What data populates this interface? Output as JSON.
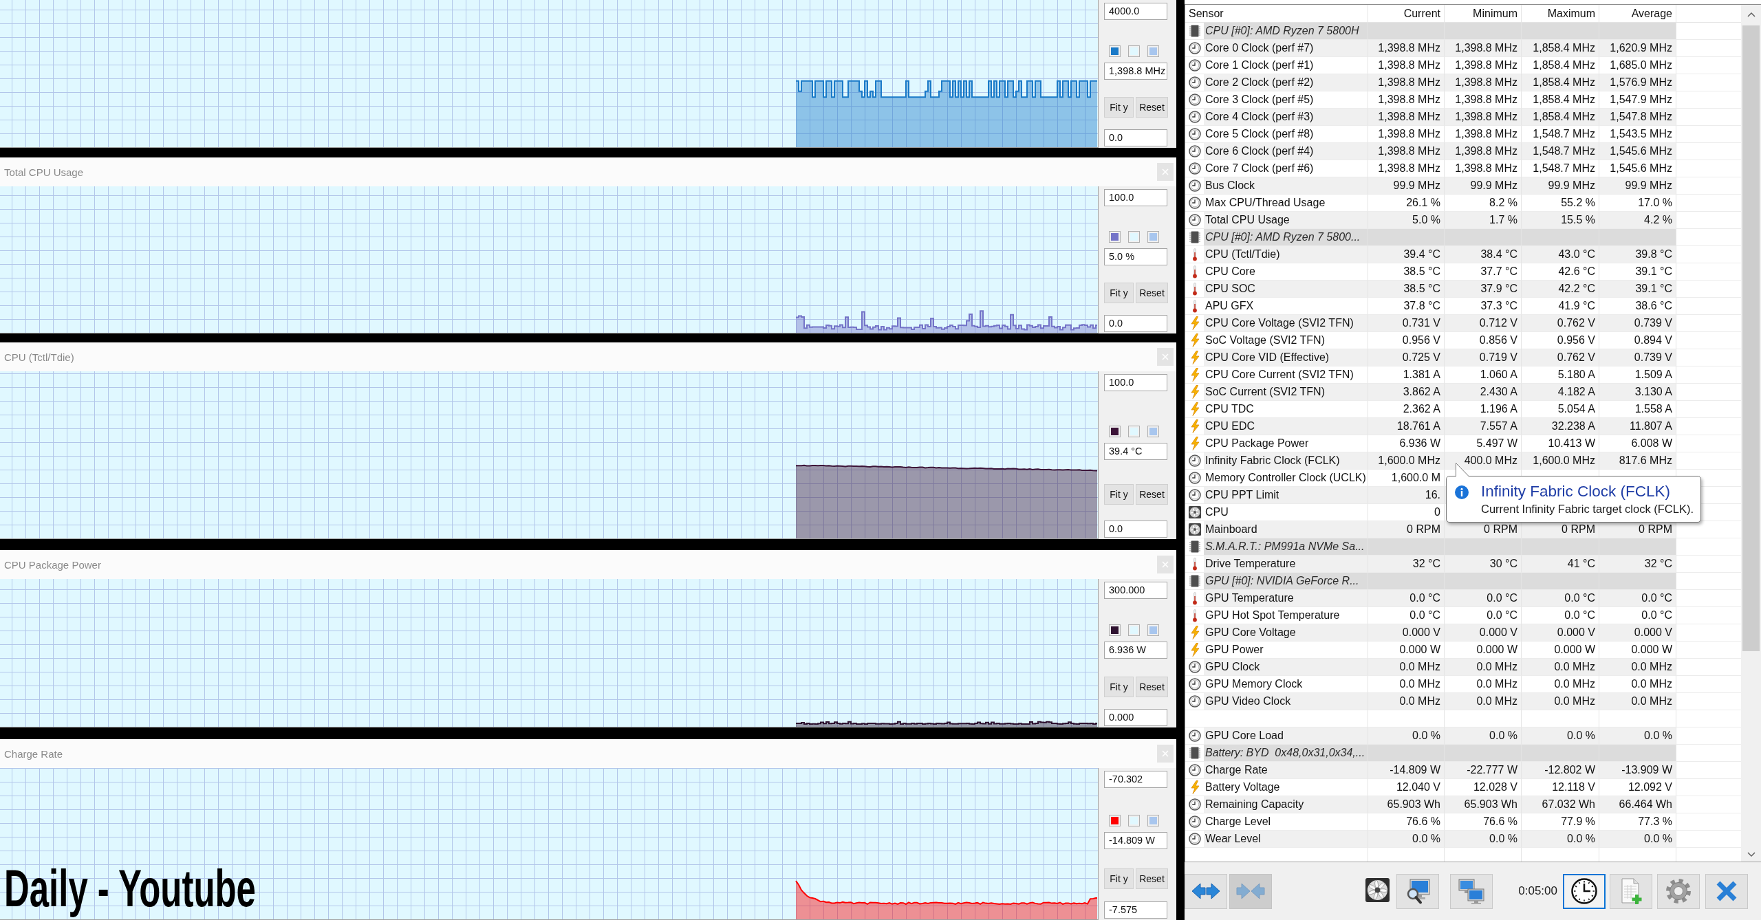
{
  "graphs": [
    {
      "kind": "clock",
      "color": "#1a7ac8",
      "max": "4000.0",
      "current": "1,398.8 MHz",
      "min": "0.0",
      "buttons": [
        "Fit y",
        "Reset"
      ]
    },
    {
      "title": "Total CPU Usage",
      "kind": "usage",
      "color": "#7474c8",
      "max": "100.0",
      "current": "5.0 %",
      "min": "0.0",
      "buttons": [
        "Fit y",
        "Reset"
      ]
    },
    {
      "title": "CPU (Tctl/Tdie)",
      "kind": "temperature",
      "color": "#3c1438",
      "max": "100.0",
      "current": "39.4 °C",
      "min": "0.0",
      "buttons": [
        "Fit y",
        "Reset"
      ]
    },
    {
      "title": "CPU Package Power",
      "kind": "power",
      "color": "#2e1230",
      "max": "300.000",
      "current": "6.936 W",
      "min": "0.000",
      "buttons": [
        "Fit y",
        "Reset"
      ]
    },
    {
      "title": "Charge Rate",
      "kind": "rate",
      "color": "#ff0000",
      "max": "-70.302",
      "current": "-14.809 W",
      "min": "-7.575",
      "buttons": [
        "Fit y",
        "Reset"
      ]
    }
  ],
  "caption": "Daily - Youtube",
  "sensors": {
    "columns": [
      "Sensor",
      "Current",
      "Minimum",
      "Maximum",
      "Average"
    ],
    "rows": [
      {
        "kind": "group",
        "name": "CPU [#0]: AMD Ryzen 7 5800H"
      },
      {
        "kind": "clock",
        "name": "Core 0 Clock (perf #7)",
        "values": [
          "1,398.8 MHz",
          "1,398.8 MHz",
          "1,858.4 MHz",
          "1,620.9 MHz"
        ]
      },
      {
        "kind": "clock",
        "name": "Core 1 Clock (perf #1)",
        "values": [
          "1,398.8 MHz",
          "1,398.8 MHz",
          "1,858.4 MHz",
          "1,685.0 MHz"
        ]
      },
      {
        "kind": "clock",
        "name": "Core 2 Clock (perf #2)",
        "values": [
          "1,398.8 MHz",
          "1,398.8 MHz",
          "1,858.4 MHz",
          "1,576.9 MHz"
        ]
      },
      {
        "kind": "clock",
        "name": "Core 3 Clock (perf #5)",
        "values": [
          "1,398.8 MHz",
          "1,398.8 MHz",
          "1,858.4 MHz",
          "1,547.9 MHz"
        ]
      },
      {
        "kind": "clock",
        "name": "Core 4 Clock (perf #3)",
        "values": [
          "1,398.8 MHz",
          "1,398.8 MHz",
          "1,858.4 MHz",
          "1,547.8 MHz"
        ]
      },
      {
        "kind": "clock",
        "name": "Core 5 Clock (perf #8)",
        "values": [
          "1,398.8 MHz",
          "1,398.8 MHz",
          "1,548.7 MHz",
          "1,543.5 MHz"
        ]
      },
      {
        "kind": "clock",
        "name": "Core 6 Clock (perf #4)",
        "values": [
          "1,398.8 MHz",
          "1,398.8 MHz",
          "1,548.7 MHz",
          "1,545.6 MHz"
        ]
      },
      {
        "kind": "clock",
        "name": "Core 7 Clock (perf #6)",
        "values": [
          "1,398.8 MHz",
          "1,398.8 MHz",
          "1,548.7 MHz",
          "1,545.6 MHz"
        ]
      },
      {
        "kind": "clock",
        "name": "Bus Clock",
        "values": [
          "99.9 MHz",
          "99.9 MHz",
          "99.9 MHz",
          "99.9 MHz"
        ]
      },
      {
        "kind": "clock",
        "name": "Max CPU/Thread Usage",
        "values": [
          "26.1 %",
          "8.2 %",
          "55.2 %",
          "17.0 %"
        ]
      },
      {
        "kind": "clock",
        "name": "Total CPU Usage",
        "values": [
          "5.0 %",
          "1.7 %",
          "15.5 %",
          "4.2 %"
        ]
      },
      {
        "kind": "group",
        "name": "CPU [#0]: AMD Ryzen 7 5800..."
      },
      {
        "kind": "temperature",
        "name": "CPU (Tctl/Tdie)",
        "values": [
          "39.4 °C",
          "38.4 °C",
          "43.0 °C",
          "39.8 °C"
        ]
      },
      {
        "kind": "temperature",
        "name": "CPU Core",
        "values": [
          "38.5 °C",
          "37.7 °C",
          "42.6 °C",
          "39.1 °C"
        ]
      },
      {
        "kind": "temperature",
        "name": "CPU SOC",
        "values": [
          "38.5 °C",
          "37.9 °C",
          "42.2 °C",
          "39.1 °C"
        ]
      },
      {
        "kind": "temperature",
        "name": "APU GFX",
        "values": [
          "37.8 °C",
          "37.3 °C",
          "41.9 °C",
          "38.6 °C"
        ]
      },
      {
        "kind": "voltage",
        "name": "CPU Core Voltage (SVI2 TFN)",
        "values": [
          "0.731 V",
          "0.712 V",
          "0.762 V",
          "0.739 V"
        ]
      },
      {
        "kind": "voltage",
        "name": "SoC Voltage (SVI2 TFN)",
        "values": [
          "0.956 V",
          "0.856 V",
          "0.956 V",
          "0.894 V"
        ]
      },
      {
        "kind": "voltage",
        "name": "CPU Core VID (Effective)",
        "values": [
          "0.725 V",
          "0.719 V",
          "0.762 V",
          "0.739 V"
        ]
      },
      {
        "kind": "voltage",
        "name": "CPU Core Current (SVI2 TFN)",
        "values": [
          "1.381 A",
          "1.060 A",
          "5.180 A",
          "1.509 A"
        ]
      },
      {
        "kind": "voltage",
        "name": "SoC Current (SVI2 TFN)",
        "values": [
          "3.862 A",
          "2.430 A",
          "4.182 A",
          "3.130 A"
        ]
      },
      {
        "kind": "voltage",
        "name": "CPU TDC",
        "values": [
          "2.362 A",
          "1.196 A",
          "5.054 A",
          "1.558 A"
        ]
      },
      {
        "kind": "voltage",
        "name": "CPU EDC",
        "values": [
          "18.761 A",
          "7.557 A",
          "32.238 A",
          "11.807 A"
        ]
      },
      {
        "kind": "voltage",
        "name": "CPU Package Power",
        "values": [
          "6.936 W",
          "5.497 W",
          "10.413 W",
          "6.008 W"
        ]
      },
      {
        "kind": "clock",
        "name": "Infinity Fabric Clock (FCLK)",
        "values": [
          "1,600.0 MHz",
          "400.0 MHz",
          "1,600.0 MHz",
          "817.6 MHz"
        ]
      },
      {
        "kind": "clock",
        "name": "Memory Controller Clock (UCLK)",
        "values": [
          "1,600.0 M"
        ]
      },
      {
        "kind": "clock",
        "name": "CPU PPT Limit",
        "values": [
          "16."
        ]
      },
      {
        "kind": "fan",
        "name": "CPU",
        "values": [
          "0"
        ]
      },
      {
        "kind": "fan",
        "name": "Mainboard",
        "values": [
          "0 RPM",
          "0 RPM",
          "0 RPM",
          "0 RPM"
        ]
      },
      {
        "kind": "group",
        "name": "S.M.A.R.T.: PM991a NVMe Sa..."
      },
      {
        "kind": "temperature",
        "name": "Drive Temperature",
        "values": [
          "32 °C",
          "30 °C",
          "41 °C",
          "32 °C"
        ]
      },
      {
        "kind": "group",
        "name": "GPU [#0]: NVIDIA GeForce R..."
      },
      {
        "kind": "temperature",
        "name": "GPU Temperature",
        "values": [
          "0.0 °C",
          "0.0 °C",
          "0.0 °C",
          "0.0 °C"
        ]
      },
      {
        "kind": "temperature",
        "name": "GPU Hot Spot Temperature",
        "values": [
          "0.0 °C",
          "0.0 °C",
          "0.0 °C",
          "0.0 °C"
        ]
      },
      {
        "kind": "voltage",
        "name": "GPU Core Voltage",
        "values": [
          "0.000 V",
          "0.000 V",
          "0.000 V",
          "0.000 V"
        ]
      },
      {
        "kind": "voltage",
        "name": "GPU Power",
        "values": [
          "0.000 W",
          "0.000 W",
          "0.000 W",
          "0.000 W"
        ]
      },
      {
        "kind": "clock",
        "name": "GPU Clock",
        "values": [
          "0.0 MHz",
          "0.0 MHz",
          "0.0 MHz",
          "0.0 MHz"
        ]
      },
      {
        "kind": "clock",
        "name": "GPU Memory Clock",
        "values": [
          "0.0 MHz",
          "0.0 MHz",
          "0.0 MHz",
          "0.0 MHz"
        ]
      },
      {
        "kind": "clock",
        "name": "GPU Video Clock",
        "values": [
          "0.0 MHz",
          "0.0 MHz",
          "0.0 MHz",
          "0.0 MHz"
        ]
      },
      {
        "kind": "blank"
      },
      {
        "kind": "clock",
        "name": "GPU Core Load",
        "values": [
          "0.0 %",
          "0.0 %",
          "0.0 %",
          "0.0 %"
        ]
      },
      {
        "kind": "group",
        "name": "Battery: BYD  0x48,0x31,0x34,..."
      },
      {
        "kind": "clock",
        "name": "Charge Rate",
        "values": [
          "-14.809 W",
          "-22.777 W",
          "-12.802 W",
          "-13.909 W"
        ]
      },
      {
        "kind": "voltage",
        "name": "Battery Voltage",
        "values": [
          "12.040 V",
          "12.028 V",
          "12.118 V",
          "12.092 V"
        ]
      },
      {
        "kind": "clock",
        "name": "Remaining Capacity",
        "values": [
          "65.903 Wh",
          "65.903 Wh",
          "67.032 Wh",
          "66.464 Wh"
        ]
      },
      {
        "kind": "clock",
        "name": "Charge Level",
        "values": [
          "76.6 %",
          "76.6 %",
          "77.9 %",
          "77.3 %"
        ]
      },
      {
        "kind": "clock",
        "name": "Wear Level",
        "values": [
          "0.0 %",
          "0.0 %",
          "0.0 %",
          "0.0 %"
        ]
      }
    ]
  },
  "tooltip": {
    "title": "Infinity Fabric Clock (FCLK)",
    "text": "Current Infinity Fabric target clock (FCLK)."
  },
  "toolbar": {
    "buttons": [
      {
        "kind": "expand",
        "disabled": false,
        "focused": false
      },
      {
        "kind": "collapse",
        "disabled": true,
        "focused": false
      },
      {
        "kind": "fan",
        "disabled": false,
        "focused": false
      },
      {
        "kind": "inspect",
        "disabled": false,
        "focused": false
      },
      {
        "kind": "network",
        "disabled": false,
        "focused": false
      },
      {
        "kind": "timer",
        "disabled": false,
        "focused": true
      },
      {
        "kind": "log",
        "disabled": false,
        "focused": false
      },
      {
        "kind": "settings",
        "disabled": false,
        "focused": false
      },
      {
        "kind": "close",
        "disabled": false,
        "focused": false
      }
    ],
    "interval": "0:05:00"
  }
}
